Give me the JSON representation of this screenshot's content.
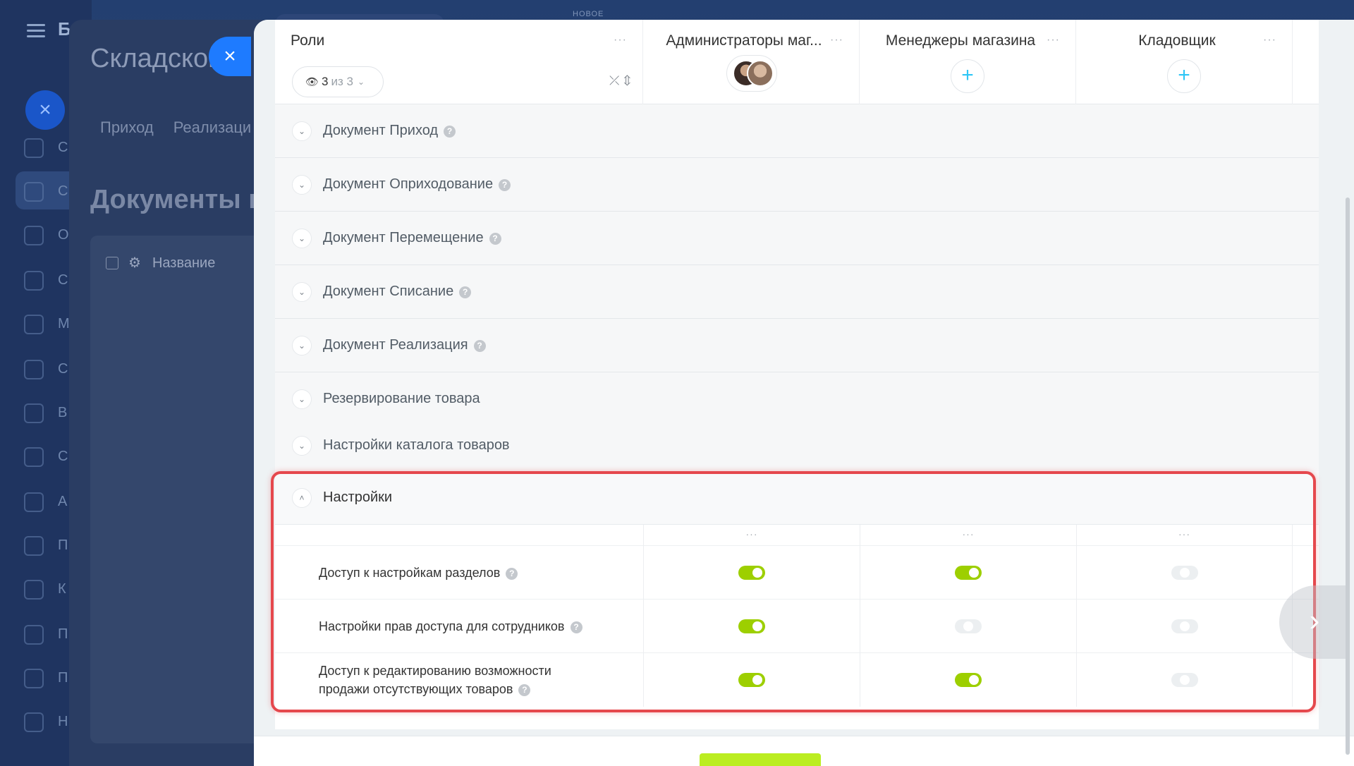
{
  "background": {
    "logo": "Б",
    "panel_title": "Складской",
    "tabs": [
      "Приход",
      "Реализаци"
    ],
    "heading": "Документы п",
    "table_header": "Название",
    "new_tag": "НОВОЕ",
    "nav_letters": [
      "С",
      "С",
      "О",
      "С",
      "М",
      "С",
      "В",
      "С",
      "А",
      "П",
      "К",
      "П",
      "П",
      "Н"
    ]
  },
  "header": {
    "roles_title": "Роли",
    "counter_value": "3",
    "counter_of": "из 3",
    "columns": [
      {
        "title": "Администраторы маг..."
      },
      {
        "title": "Менеджеры магазина"
      },
      {
        "title": "Кладовщик"
      }
    ],
    "dots": "···"
  },
  "sections": [
    {
      "label": "Документ Приход",
      "help": true
    },
    {
      "label": "Документ Оприходование",
      "help": true
    },
    {
      "label": "Документ Перемещение",
      "help": true
    },
    {
      "label": "Документ Списание",
      "help": true
    },
    {
      "label": "Документ Реализация",
      "help": true
    },
    {
      "label": "Резервирование товара",
      "help": false
    },
    {
      "label": "Настройки каталога товаров",
      "help": false
    }
  ],
  "settings": {
    "title": "Настройки",
    "rows": [
      {
        "line1": "Доступ к настройкам разделов",
        "line2": "",
        "values": [
          true,
          true,
          false
        ]
      },
      {
        "line1": "Настройки прав доступа для сотрудников",
        "line2": "",
        "values": [
          true,
          false,
          false
        ]
      },
      {
        "line1": "Доступ к редактированию возможности",
        "line2": "продажи отсутствующих товаров",
        "values": [
          true,
          true,
          false
        ]
      }
    ]
  },
  "colors": {
    "accent_toggle": "#9dcf00",
    "highlight": "#e5484d",
    "plus": "#2fc6f6",
    "save": "#bbed21"
  }
}
